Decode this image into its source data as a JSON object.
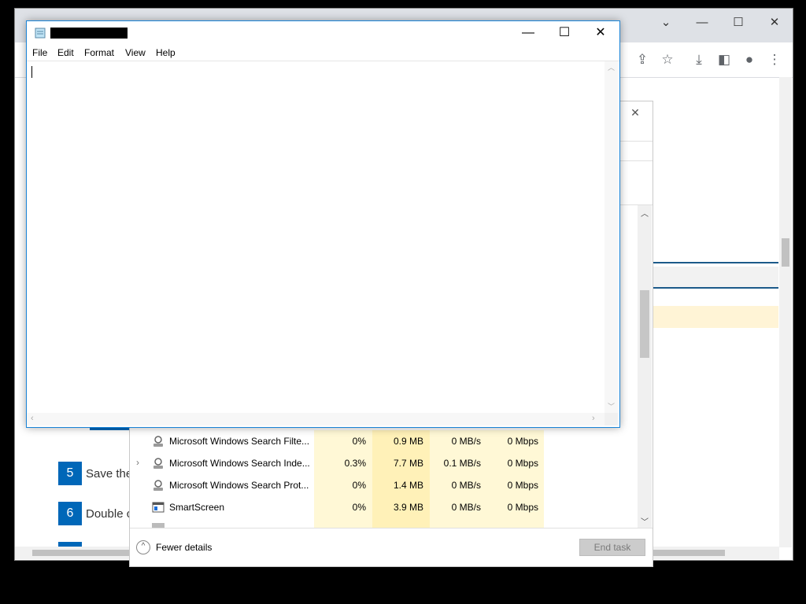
{
  "notepad": {
    "title_redacted": true,
    "menu": [
      "File",
      "Edit",
      "Format",
      "View",
      "Help"
    ],
    "controls": {
      "minimize": "—",
      "maximize": "☐",
      "close": "✕"
    },
    "content": ""
  },
  "browser": {
    "controls": {
      "collapse": "⌄",
      "minimize": "—",
      "maximize": "☐",
      "close": "✕"
    },
    "toolbar_icons": [
      "share-icon",
      "star-icon",
      "download-icon",
      "sidebar-icon",
      "profile-icon",
      "more-icon"
    ],
    "steps": [
      {
        "number": "5",
        "text": "Save the"
      },
      {
        "number": "6",
        "text": "Double c"
      }
    ]
  },
  "task_manager": {
    "rows": [
      {
        "name": "Microsoft Windows Search Filte...",
        "cpu": "0%",
        "memory": "0.9 MB",
        "disk": "0 MB/s",
        "network": "0 Mbps",
        "expandable": false
      },
      {
        "name": "Microsoft Windows Search Inde...",
        "cpu": "0.3%",
        "memory": "7.7 MB",
        "disk": "0.1 MB/s",
        "network": "0 Mbps",
        "expandable": true
      },
      {
        "name": "Microsoft Windows Search Prot...",
        "cpu": "0%",
        "memory": "1.4 MB",
        "disk": "0 MB/s",
        "network": "0 Mbps",
        "expandable": false
      },
      {
        "name": "SmartScreen",
        "cpu": "0%",
        "memory": "3.9 MB",
        "disk": "0 MB/s",
        "network": "0 Mbps",
        "expandable": false
      }
    ],
    "fewer_details": "Fewer details",
    "end_task": "End task",
    "close": "✕"
  }
}
